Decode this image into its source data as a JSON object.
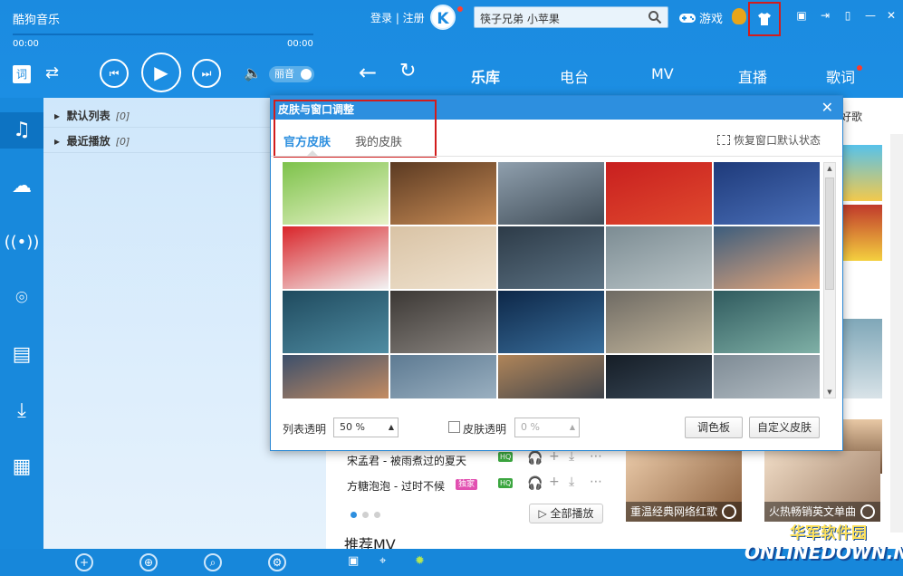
{
  "app": {
    "title": "酷狗音乐",
    "login": "登录 | 注册",
    "logo_letter": "K",
    "search_text": "筷子兄弟  小苹果",
    "game_label": "游戏"
  },
  "player": {
    "time_current": "00:00",
    "time_total": "00:00",
    "lyric_button": "词",
    "quality_label": "丽音"
  },
  "nav_tabs": [
    "乐库",
    "电台",
    "MV",
    "直播",
    "歌词"
  ],
  "playlist": {
    "items": [
      {
        "name": "默认列表",
        "count": "[0]"
      },
      {
        "name": "最近播放",
        "count": "[0]"
      }
    ]
  },
  "dialog": {
    "title": "皮肤与窗口调整",
    "tabs": [
      "官方皮肤",
      "我的皮肤"
    ],
    "restore_label": "恢复窗口默认状态",
    "list_opacity_label": "列表透明",
    "list_opacity_value": "50 %",
    "skin_opacity_label": "皮肤透明",
    "skin_opacity_value": "0 %",
    "palette_button": "调色板",
    "custom_button": "自定义皮肤",
    "skins": [
      {
        "name": "dragon-boat",
        "c1": "#7dc24a",
        "c2": "#e8f3c9"
      },
      {
        "name": "concert",
        "c1": "#5b3a22",
        "c2": "#c78b55"
      },
      {
        "name": "couple",
        "c1": "#8f9fad",
        "c2": "#3f4c57"
      },
      {
        "name": "new-year-red",
        "c1": "#c81f1f",
        "c2": "#e04a2e"
      },
      {
        "name": "night-blue",
        "c1": "#1e3a7a",
        "c2": "#4a6fb8"
      },
      {
        "name": "santa",
        "c1": "#d9252a",
        "c2": "#f2f2f2"
      },
      {
        "name": "beige",
        "c1": "#d9c3a5",
        "c2": "#efe2cf"
      },
      {
        "name": "bulb",
        "c1": "#2d3b48",
        "c2": "#5c7283"
      },
      {
        "name": "rails",
        "c1": "#7c8c93",
        "c2": "#b9c4c7"
      },
      {
        "name": "boat",
        "c1": "#3c5d7d",
        "c2": "#e8a77a"
      },
      {
        "name": "forest",
        "c1": "#1f4a5e",
        "c2": "#4f8ca2"
      },
      {
        "name": "squirrel",
        "c1": "#3c3835",
        "c2": "#8a8580"
      },
      {
        "name": "jellyfish",
        "c1": "#0d2748",
        "c2": "#3a6f9c"
      },
      {
        "name": "beach-girl",
        "c1": "#6e6a63",
        "c2": "#c4b79d"
      },
      {
        "name": "sprout",
        "c1": "#2f5a5e",
        "c2": "#7fb0a6"
      },
      {
        "name": "sunset",
        "c1": "#3c4f6b",
        "c2": "#e39a5f"
      },
      {
        "name": "frost",
        "c1": "#5d7a92",
        "c2": "#a8bccb"
      },
      {
        "name": "leaf",
        "c1": "#b08559",
        "c2": "#253447"
      },
      {
        "name": "dark-leaves",
        "c1": "#151d26",
        "c2": "#445566"
      },
      {
        "name": "mist",
        "c1": "#7e8b95",
        "c2": "#c0c9cf"
      }
    ]
  },
  "main": {
    "good_songs": "好歌",
    "songs": [
      {
        "title": "宋孟君 - 被雨煮过的夏天",
        "badge": "HQ"
      },
      {
        "title": "方糖泡泡 - 过时不候",
        "badge": "HQ",
        "solo": "独家"
      }
    ],
    "play_all": "全部播放",
    "recommend_mv": "推荐MV",
    "mv_cards": [
      {
        "caption": "重温经典网络红歌"
      },
      {
        "caption": "火热畅销英文单曲"
      }
    ]
  },
  "watermark": {
    "cn": "华军软件园",
    "en": "ONLINEDOWN.NET"
  },
  "colors": {
    "brand_blue": "#1b8be0",
    "highlight_red": "#d21c1c",
    "active_tab": "#2d8fdf"
  }
}
